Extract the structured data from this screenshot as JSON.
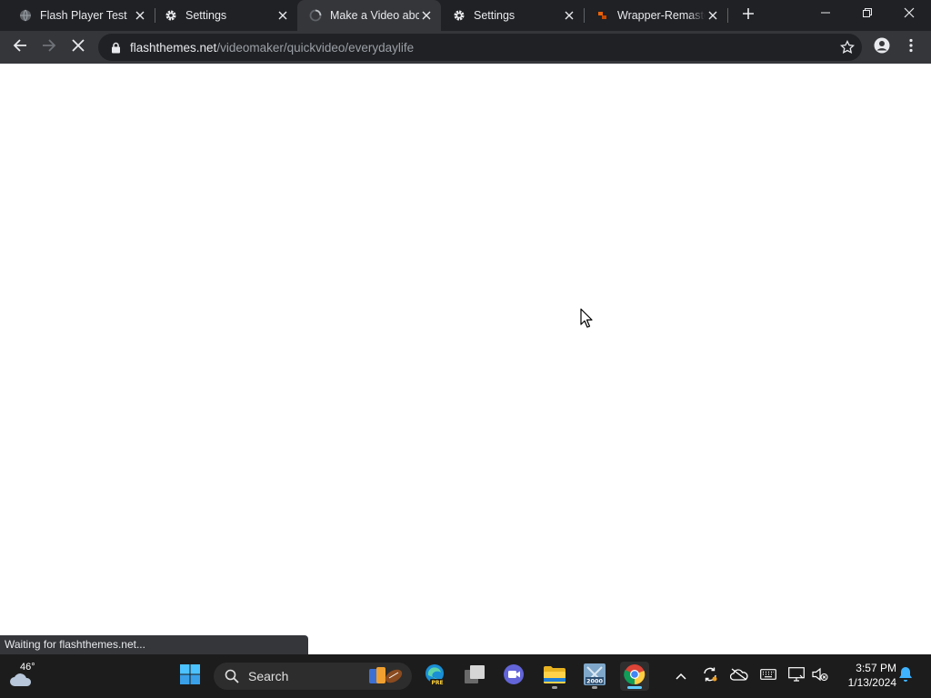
{
  "browser": {
    "tabs": [
      {
        "title": "Flash Player Test",
        "icon": "globe-icon",
        "active": false
      },
      {
        "title": "Settings",
        "icon": "gear-icon",
        "active": false
      },
      {
        "title": "Make a Video abc",
        "icon": "loading-spinner-icon",
        "active": true
      },
      {
        "title": "Settings",
        "icon": "gear-icon",
        "active": false
      },
      {
        "title": "Wrapper-Remasto",
        "icon": "wrapper-favicon",
        "active": false
      }
    ],
    "new_tab_icon": "plus-icon",
    "window_controls": [
      "minimize-icon",
      "restore-icon",
      "close-icon"
    ]
  },
  "toolbar": {
    "url_host": "flashthemes.net",
    "url_path": "/videomaker/quickvideo/everydaylife",
    "nav_icons": [
      "back-arrow-icon",
      "forward-arrow-icon",
      "stop-loading-icon"
    ],
    "right_icons": [
      "bookmark-star-icon",
      "profile-icon",
      "kebab-menu-icon"
    ]
  },
  "status": {
    "text": "Waiting for flashthemes.net..."
  },
  "taskbar": {
    "weather_temp": "46°",
    "search_label": "Search",
    "clock_time": "3:57 PM",
    "clock_date": "1/13/2024",
    "apps": [
      "start-icon",
      "edge-pre-icon",
      "task-view-icon",
      "teams-icon",
      "file-explorer-icon",
      "windows-2000-icon",
      "chrome-icon"
    ],
    "tray": [
      "chevron-up-icon",
      "sync-icon",
      "onedrive-off-icon",
      "keyboard-icon",
      "display-icon",
      "volume-muted-icon",
      "notification-bell-icon"
    ]
  },
  "colors": {
    "tabstrip": "#202124",
    "active_tab": "#35363a",
    "taskbar": "#1c1c1c",
    "accent": "#60cdff"
  }
}
